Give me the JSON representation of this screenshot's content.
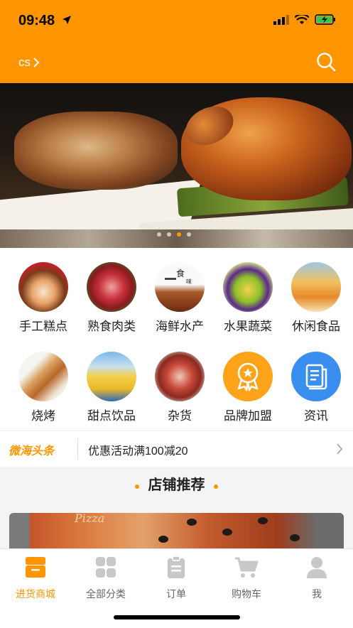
{
  "status": {
    "time": "09:48"
  },
  "header": {
    "city": "cs"
  },
  "menu": [
    {
      "label": "手工糕点",
      "icon": "cake-icon"
    },
    {
      "label": "熟食肉类",
      "icon": "meat-icon"
    },
    {
      "label": "海鲜水产",
      "icon": "seafood-icon"
    },
    {
      "label": "水果蔬菜",
      "icon": "fruit-icon"
    },
    {
      "label": "休闲食品",
      "icon": "snack-icon"
    },
    {
      "label": "烧烤",
      "icon": "bbq-icon"
    },
    {
      "label": "甜点饮品",
      "icon": "dessert-icon"
    },
    {
      "label": "杂货",
      "icon": "grocery-icon"
    },
    {
      "label": "品牌加盟",
      "icon": "brand-medal-icon"
    },
    {
      "label": "资讯",
      "icon": "news-doc-icon"
    }
  ],
  "news": {
    "logo": "微海头条",
    "text": "优惠活动满100减20"
  },
  "section": {
    "title": "店铺推荐"
  },
  "store": {
    "banner_text": "Pizza"
  },
  "tabs": [
    {
      "label": "进货商城",
      "icon": "store-icon",
      "active": true
    },
    {
      "label": "全部分类",
      "icon": "grid-icon",
      "active": false
    },
    {
      "label": "订单",
      "icon": "clipboard-icon",
      "active": false
    },
    {
      "label": "购物车",
      "icon": "cart-icon",
      "active": false
    },
    {
      "label": "我",
      "icon": "user-icon",
      "active": false
    }
  ],
  "colors": {
    "accent": "#ff9500",
    "blue": "#3a8ef0"
  }
}
